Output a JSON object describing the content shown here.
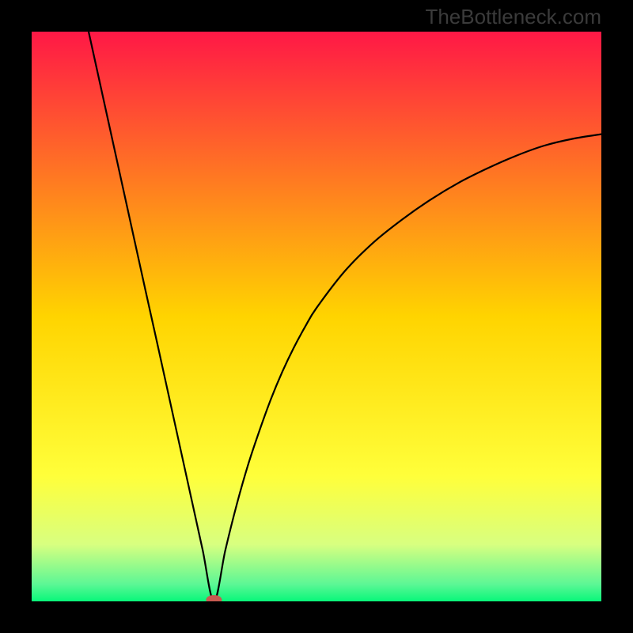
{
  "watermark": "TheBottleneck.com",
  "chart_data": {
    "type": "line",
    "title": "",
    "xlabel": "",
    "ylabel": "",
    "xlim": [
      0,
      100
    ],
    "ylim": [
      0,
      100
    ],
    "grid": false,
    "legend": false,
    "background_gradient": {
      "stops": [
        {
          "offset": 0.0,
          "color": "#ff1846"
        },
        {
          "offset": 0.5,
          "color": "#ffd400"
        },
        {
          "offset": 0.78,
          "color": "#ffff3a"
        },
        {
          "offset": 0.9,
          "color": "#d8ff80"
        },
        {
          "offset": 0.97,
          "color": "#5cf795"
        },
        {
          "offset": 1.0,
          "color": "#08f77a"
        }
      ]
    },
    "curve": {
      "minimum_x": 32,
      "left_branch_top_x": 10,
      "right_branch_top_y": 82,
      "points": [
        {
          "x": 10.0,
          "y": 100.0
        },
        {
          "x": 12.0,
          "y": 90.9
        },
        {
          "x": 14.0,
          "y": 81.8
        },
        {
          "x": 16.0,
          "y": 72.7
        },
        {
          "x": 18.0,
          "y": 63.6
        },
        {
          "x": 20.0,
          "y": 54.5
        },
        {
          "x": 22.0,
          "y": 45.5
        },
        {
          "x": 24.0,
          "y": 36.4
        },
        {
          "x": 26.0,
          "y": 27.3
        },
        {
          "x": 28.0,
          "y": 18.2
        },
        {
          "x": 30.0,
          "y": 9.1
        },
        {
          "x": 32.0,
          "y": 0.0
        },
        {
          "x": 34.0,
          "y": 9.0
        },
        {
          "x": 36.0,
          "y": 17.0
        },
        {
          "x": 38.0,
          "y": 24.0
        },
        {
          "x": 40.0,
          "y": 30.0
        },
        {
          "x": 42.0,
          "y": 35.5
        },
        {
          "x": 44.0,
          "y": 40.3
        },
        {
          "x": 46.0,
          "y": 44.5
        },
        {
          "x": 48.0,
          "y": 48.2
        },
        {
          "x": 50.0,
          "y": 51.5
        },
        {
          "x": 55.0,
          "y": 58.0
        },
        {
          "x": 60.0,
          "y": 63.0
        },
        {
          "x": 65.0,
          "y": 67.0
        },
        {
          "x": 70.0,
          "y": 70.5
        },
        {
          "x": 75.0,
          "y": 73.5
        },
        {
          "x": 80.0,
          "y": 76.0
        },
        {
          "x": 85.0,
          "y": 78.2
        },
        {
          "x": 90.0,
          "y": 80.0
        },
        {
          "x": 95.0,
          "y": 81.2
        },
        {
          "x": 100.0,
          "y": 82.0
        }
      ]
    },
    "marker": {
      "x": 32,
      "y": 0,
      "color": "#c85a50",
      "rx": 10,
      "ry": 6
    }
  }
}
